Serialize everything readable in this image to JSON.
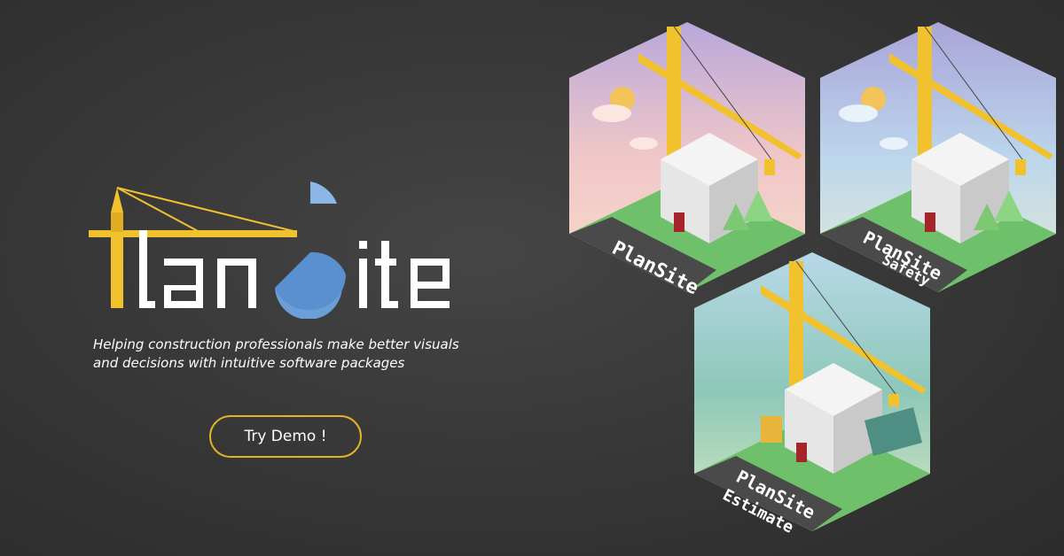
{
  "brand": {
    "logo_text_part1": "Plan",
    "logo_text_part2": "Site",
    "colors": {
      "crane_yellow": "#f2c12e",
      "blue": "#6a9fd8",
      "white": "#ffffff"
    }
  },
  "hero": {
    "tagline": "Helping construction professionals make better visuals and decisions with intuitive software packages",
    "cta_label": "Try Demo !"
  },
  "products": [
    {
      "name": "PlanSite",
      "subtitle": ""
    },
    {
      "name": "PlanSite",
      "subtitle": "Safety"
    },
    {
      "name": "PlanSite",
      "subtitle": "Estimate"
    }
  ]
}
